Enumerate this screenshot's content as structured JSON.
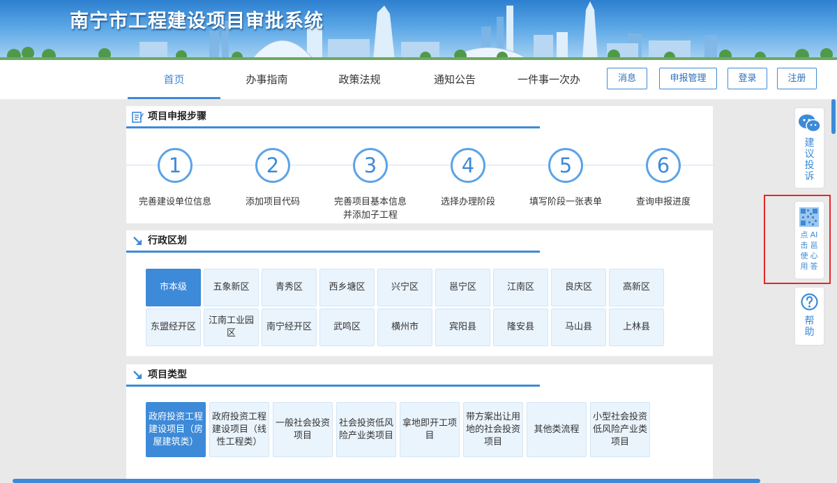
{
  "banner": {
    "title": "南宁市工程建设项目审批系统"
  },
  "nav": {
    "items": [
      "首页",
      "办事指南",
      "政策法规",
      "通知公告",
      "一件事一次办"
    ],
    "buttons": [
      "消息",
      "申报管理",
      "登录",
      "注册"
    ]
  },
  "steps": {
    "title": "项目申报步骤",
    "items": [
      {
        "num": "1",
        "label": "完善建设单位信息"
      },
      {
        "num": "2",
        "label": "添加项目代码"
      },
      {
        "num": "3",
        "label": "完善项目基本信息并添加子工程"
      },
      {
        "num": "4",
        "label": "选择办理阶段"
      },
      {
        "num": "5",
        "label": "填写阶段一张表单"
      },
      {
        "num": "6",
        "label": "查询申报进度"
      }
    ]
  },
  "districts": {
    "title": "行政区划",
    "row1": [
      "市本级",
      "五象新区",
      "青秀区",
      "西乡塘区",
      "兴宁区",
      "邕宁区",
      "江南区",
      "良庆区",
      "高新区"
    ],
    "row2": [
      "东盟经开区",
      "江南工业园区",
      "南宁经开区",
      "武鸣区",
      "横州市",
      "宾阳县",
      "隆安县",
      "马山县",
      "上林县"
    ],
    "active": "市本级"
  },
  "project_types": {
    "title": "项目类型",
    "items": [
      "政府投资工程建设项目（房屋建筑类）",
      "政府投资工程建设项目（线性工程类）",
      "一般社会投资项目",
      "社会投资低风险产业类项目",
      "拿地即开工项目",
      "带方案出让用地的社会投资项目",
      "其他类流程",
      "小型社会投资低风险产业类项目"
    ],
    "active_index": 0
  },
  "side": {
    "feedback": [
      "建",
      "议",
      "投",
      "诉"
    ],
    "ai_cols": [
      [
        "点",
        "击",
        "使",
        "用"
      ],
      [
        "AI",
        "邕",
        "心",
        "答"
      ]
    ],
    "help": [
      "帮",
      "助"
    ]
  },
  "colors": {
    "accent": "#3d8ad8",
    "highlight_box": "#e4262a"
  }
}
